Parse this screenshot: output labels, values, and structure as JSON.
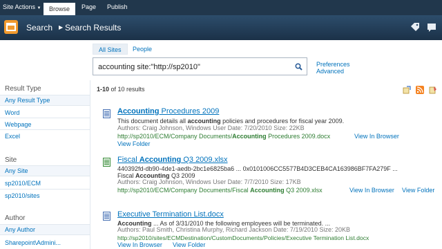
{
  "ribbon": {
    "site_actions": "Site Actions",
    "tabs": [
      "Browse",
      "Page",
      "Publish"
    ]
  },
  "header": {
    "breadcrumb_root": "Search",
    "breadcrumb_current": "Search Results"
  },
  "search": {
    "tabs": [
      "All Sites",
      "People"
    ],
    "query": "accounting site:\"http://sp2010\"",
    "preferences": "Preferences",
    "advanced": "Advanced"
  },
  "refinement": {
    "result_type_heading": "Result Type",
    "result_type_items": [
      "Any Result Type",
      "Word",
      "Webpage",
      "Excel"
    ],
    "site_heading": "Site",
    "site_items": [
      "Any Site",
      "sp2010/ECM",
      "sp2010/sites"
    ],
    "author_heading": "Author",
    "author_items": [
      "Any Author",
      "Sharepoint\\Admini..."
    ]
  },
  "results_summary": {
    "range": "1-10",
    "rest": " of 10 results"
  },
  "results": [
    {
      "title_bold": "Accounting",
      "title_rest": " Procedures 2009",
      "snippet_pre": "This document details all ",
      "snippet_bold": "accounting",
      "snippet_post": " policies and procedures for fiscal year 2009.",
      "meta": "Authors: Craig Johnson, Windows User   Date: 7/20/2010   Size: 22KB",
      "url_pre": "http://sp2010/ECM/Company Documents/",
      "url_bold": "Accounting",
      "url_post": " Procedures 2009.docx",
      "view_in_browser": "View In Browser",
      "view_folder": "View Folder"
    },
    {
      "title_pre": "Fiscal ",
      "title_bold": "Accounting",
      "title_rest": " Q3 2009.xlsx",
      "snippet1": "440392fd-db90-4de1-aedb-2bc1e6825ba6 ... 0x0101006CC5577B4D3CEB4CA163986BF7FA279F ...",
      "snippet2_pre": "Fiscal ",
      "snippet2_bold": "Accounting",
      "snippet2_post": " Q3 2009",
      "meta": "Authors: Craig Johnson, Windows User   Date: 7/7/2010   Size: 17KB",
      "url_pre": "http://sp2010/ECM/Company Documents/Fiscal ",
      "url_bold": "Accounting",
      "url_post": " Q3 2009.xlsx",
      "view_in_browser": "View In Browser",
      "view_folder": "View Folder"
    },
    {
      "title": "Executive Termination List.docx",
      "snippet_bold": "Accounting",
      "snippet_post": " ... As of 3/31/2010 the following employees will be terminated. ...",
      "meta": "Authors: Paul Smith, Christina Murphy, Richard Jackson   Date: 7/19/2010   Size: 20KB",
      "url": "http://sp2010/sites/ECMDestination/CustomDocuments/Policies/Executive Termination List.docx",
      "view_in_browser": "View In Browser",
      "view_folder": "View Folder"
    }
  ],
  "colors": {
    "ribbon": "#21374c",
    "link": "#0072bc",
    "url_green": "#2e7d32",
    "logo": "#f29a2e"
  }
}
